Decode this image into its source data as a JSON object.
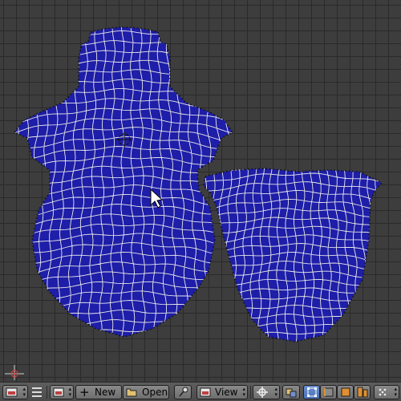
{
  "editor": {
    "type": "uv-image-editor",
    "pivot_icon": "pivot-crosshair-icon",
    "cursor_icon": "mouse-pointer-icon"
  },
  "colors": {
    "background": "#3d3d3d",
    "grid": "#2a2a2a",
    "face_fill": "#1e1ea8",
    "edge": "#e8e8e8",
    "vertex": "#111111"
  },
  "header": {
    "editor_type_icon": "image-editor-icon",
    "menu_icon": "hamburger-menu-icon",
    "image_browse_icon": "image-browse-icon",
    "new_label": "New",
    "open_label": "Open",
    "pin_icon": "pin-icon",
    "view_label": "View",
    "pivot_icon": "pivot-center-icon",
    "sync_icon": "uv-sync-icon",
    "select_mode_icons": [
      "vertex-select-icon",
      "edge-select-icon",
      "face-select-icon",
      "island-select-icon"
    ],
    "sticky_icon": "sticky-select-icon"
  }
}
